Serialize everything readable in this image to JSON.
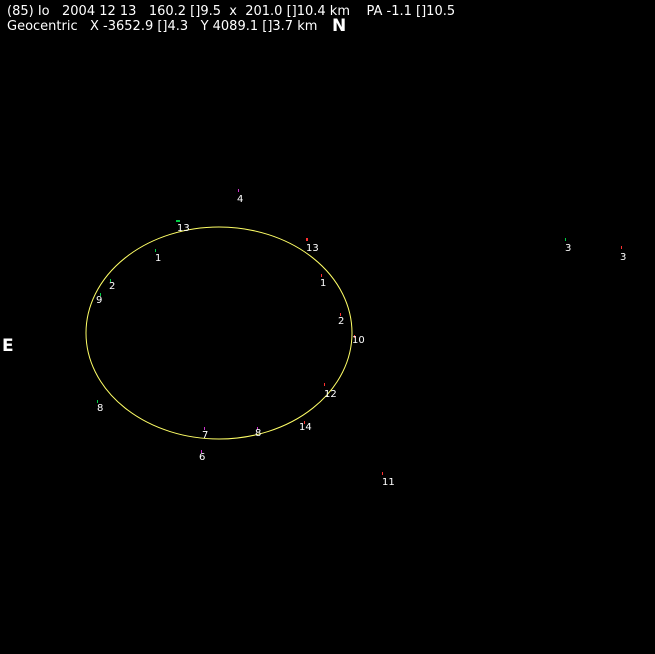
{
  "header": {
    "line1": "(85) Io   2004 12 13   160.2 []9.5  x  201.0 []10.4 km    PA -1.1 []10.5",
    "line2": "Geocentric   X -3652.9 []4.3   Y 4089.1 []3.7 km"
  },
  "compass": {
    "north": "N",
    "east": "E"
  },
  "colors": {
    "background": "#000000",
    "text": "#ffffff",
    "ellipse": "#ffff66",
    "green_marker": "#00cc44",
    "red_marker": "#ff3030",
    "magenta_marker": "#cc33cc"
  },
  "chords": [
    {
      "label": "13",
      "color": "#00cc44"
    },
    {
      "label": "1",
      "color": "#00cc44"
    },
    {
      "label": "2",
      "color": "#00cc44"
    },
    {
      "label": "9",
      "color": "#00cc44"
    },
    {
      "label": "8",
      "color": "#00cc44"
    },
    {
      "label": "7",
      "color": "#cc33cc"
    },
    {
      "label": "6",
      "color": "#cc33cc"
    },
    {
      "label": "4",
      "color": "#cc33cc"
    },
    {
      "label": "8",
      "color": "#cc33cc"
    },
    {
      "label": "14",
      "color": "#ff3030"
    },
    {
      "label": "13",
      "color": "#ff3030"
    },
    {
      "label": "1",
      "color": "#ff3030"
    },
    {
      "label": "2",
      "color": "#ff3030"
    },
    {
      "label": "10",
      "color": "#ff3030"
    },
    {
      "label": "12",
      "color": "#ff3030"
    },
    {
      "label": "11",
      "color": "#ff3030"
    },
    {
      "label": "3",
      "color": "#00cc44"
    },
    {
      "label": "3",
      "color": "#ff3030"
    }
  ]
}
